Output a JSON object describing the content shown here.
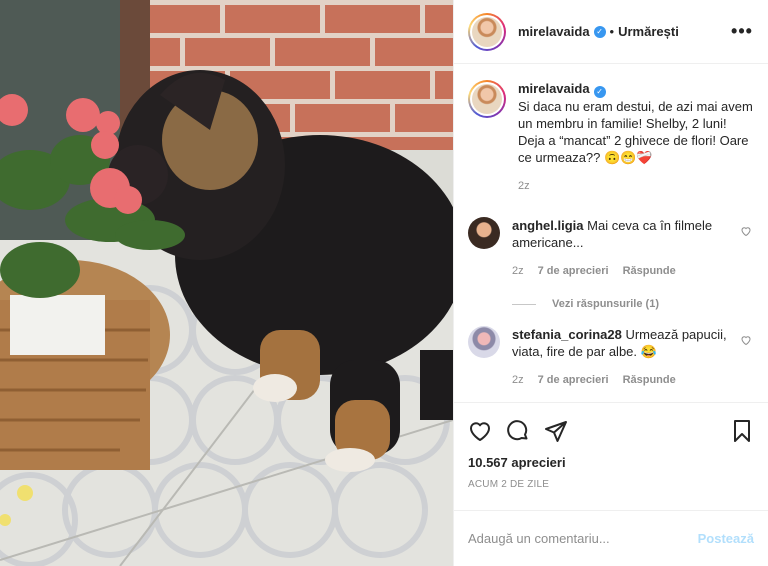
{
  "post": {
    "username": "mirelavaida",
    "follow_status": "Urmărești",
    "separator": "•",
    "more_label": "•••"
  },
  "caption": {
    "username": "mirelavaida",
    "text": "Si daca nu eram destui, de azi mai avem un membru in familie! Shelby, 2 luni! Deja a “mancat” 2 ghivece de flori! Oare ce urmeaza?? 🙃😁❤️‍🩹",
    "time": "2z"
  },
  "comments": [
    {
      "username": "anghel.ligia",
      "text": "Mai ceva ca în filmele americane...",
      "time": "2z",
      "likes": "7 de aprecieri",
      "reply": "Răspunde",
      "view_replies": "Vezi răspunsurile (1)"
    },
    {
      "username": "stefania_corina28",
      "text": "Urmează papucii, viata, fire de par albe. 😂",
      "time": "2z",
      "likes": "7 de aprecieri",
      "reply": "Răspunde"
    }
  ],
  "footer": {
    "likes": "10.567 aprecieri",
    "posted_ago": "ACUM 2 DE ZILE"
  },
  "add_comment": {
    "placeholder": "Adaugă un comentariu...",
    "post_label": "Postează"
  },
  "icons": [
    "heart-icon",
    "comment-icon",
    "share-icon",
    "bookmark-icon",
    "verified-icon",
    "more-icon"
  ],
  "colors": {
    "verified": "#3897f0",
    "post_button_disabled": "#b2dffc",
    "muted_text": "#8e8e8e"
  }
}
